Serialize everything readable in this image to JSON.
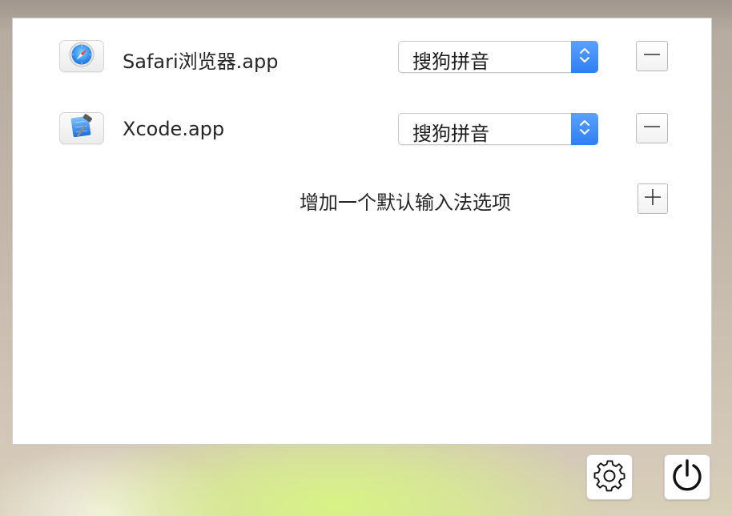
{
  "apps": [
    {
      "name": "Safari浏览器.app",
      "icon": "safari-compass-icon",
      "input_method": "搜狗拼音",
      "remove_icon": "minus-icon"
    },
    {
      "name": "Xcode.app",
      "icon": "xcode-hammer-icon",
      "input_method": "搜狗拼音",
      "remove_icon": "minus-icon"
    }
  ],
  "add_option": {
    "label": "增加一个默认输入法选项",
    "icon": "plus-icon"
  },
  "toolbar": {
    "settings_icon": "gear-icon",
    "quit_icon": "power-icon"
  },
  "colors": {
    "accent_blue": "#2f7ef4",
    "panel_bg": "#ffffff"
  }
}
